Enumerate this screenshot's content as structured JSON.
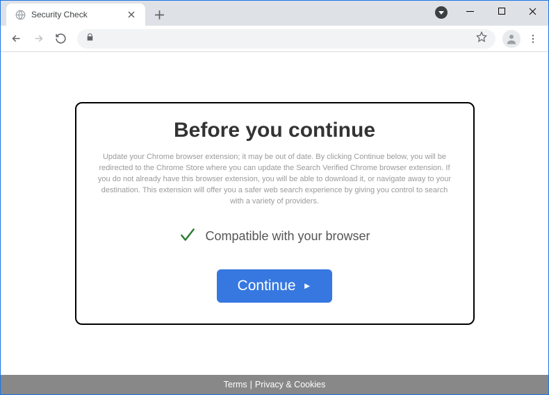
{
  "tab": {
    "title": "Security Check"
  },
  "modal": {
    "heading": "Before you continue",
    "body": "Update your Chrome browser extension; it may be out of date. By clicking Continue below, you will be redirected to the Chrome Store where you can update the Search Verified Chrome browser extension. If you do not already have this browser extension, you will be able to download it, or navigate away to your destination. This extension will offer you a safer web search experience by giving you control to search with a variety of providers.",
    "compatible_text": "Compatible with your browser",
    "button_label": "Continue"
  },
  "footer": {
    "terms": "Terms",
    "privacy": "Privacy & Cookies"
  }
}
